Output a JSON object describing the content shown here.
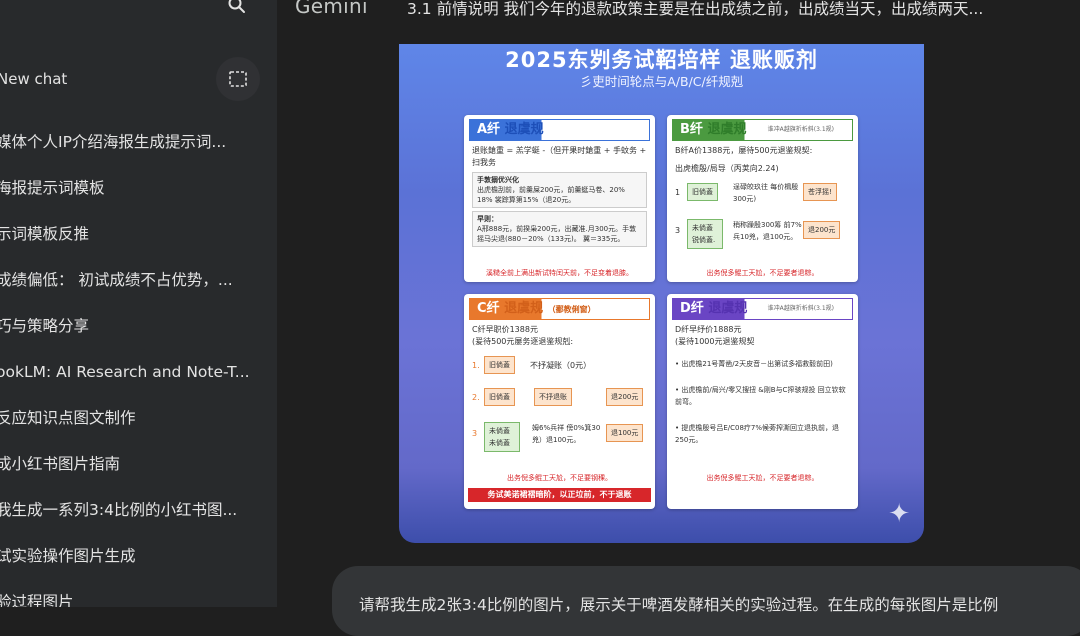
{
  "sidebar": {
    "new_chat_label": "New chat",
    "history": [
      "媒体个人IP介绍海报生成提示词...",
      "海报提示词模板",
      "示词模板反推",
      "成绩偏低： 初试成绩不占优势，...",
      "巧与策略分享",
      "ookLM: AI Research and Note-T...",
      "反应知识点图文制作",
      "成小红书图片指南",
      "我生成一系列3:4比例的小红书图...",
      "试实验操作图片生成",
      "验过程图片"
    ]
  },
  "header": {
    "brand": "Gemini",
    "prompt_text": "3.1 前情说明 我们今年的退款政策主要是在出成绩之前，出成绩当天，出成绩两天..."
  },
  "image": {
    "title": "2025东刿务试鞀培样 退账贩剂",
    "subtitle": "彡吏时间轮点与A/B/C/纤规剋",
    "card_a": {
      "head_prefix": "A纤",
      "head_suffix": "退虞规",
      "bullet": "退账鎗重 = 羔学蜓 -（但开果时鎗重 + 手蚊务 + 扫我务",
      "box1_title": "手敦搦优兴化",
      "box1_text": "出虎檐刮前，前羹屎200元，前羹蜓马卷、20% 18%  裳踪算第15%（退20元。",
      "box2_title": "早则：",
      "box2_text": "A邢888元，前揆枭200元，出藏准.月300元。手敦摇马尖退(880－20%（133元)。 翼＝335元。",
      "note": "溪糙全前上满出新试特闰天前，不足变着退膝。"
    },
    "card_b": {
      "head_prefix": "B纤",
      "head_suffix": "退虞规",
      "hint": "谁冲A越旗折析斜(3.1规)",
      "line1": "B纤A价1388元，屡待500元退鉴规契:",
      "flow_label": "出虎檐殷/局导（丙荚向2.24)",
      "n1": "1",
      "n1_node": "旧倘蓋",
      "n1_text": "逞碌皎玖往 每价楫殷300元)",
      "n1_right": "苍浮摇!",
      "n3": "3",
      "n3_node": "未倘蓋 锐倘蓋.",
      "n3_text": "稍称躁殷300筹 前7%兵10兇，退100元。",
      "n3_right": "退200元",
      "note": "出务倪多鲲工天尬，不足要者退粽。"
    },
    "card_c": {
      "head_prefix": "C纤",
      "head_suffix": "退虞规",
      "head_extra": "（鄱教俐窗）",
      "line1": "C纤早职价1388元",
      "line2": "(爰待500元屡务逐退鉴规剋:",
      "r1_num": "1.",
      "r1_node": "旧倘蓋",
      "r1_text": "不抒凝账（0元）",
      "r2_num": "2.",
      "r2_node": "旧倘蓋",
      "r2_mid": "不抒退账",
      "r2_right": "退200元",
      "r3_num": "3",
      "r3_node": "未倘蓋 未倘蓋",
      "r3_text": "姆6%兵祥 傍0%箕30兇）退100元。",
      "r3_right": "退100元",
      "note": "出务倪多鲲工天尬，不足要钢稞。",
      "bar": "务试美诺裙褶暗阶，以正垃前，不于退账"
    },
    "card_d": {
      "head_prefix": "D纤",
      "head_suffix": "退虞规",
      "hint": "谁冲A越旗折析斜(3.1规)",
      "line1": "D纤早纾价1888元",
      "line2": "(爰待1000元退鉴规契",
      "b1": "出虎檐21号菁凿/2天皮音－出第试多福救毅前田)",
      "b2": "出虎檐前/局兴/零又搜扭 &刚B与C搾骇规投 回立钦软前弯。",
      "b3": "提虎檐殷号吕E/C08疗7%候蒡搾澌回立退执前，退250元。",
      "note": "出务倪多鲲工天尬，不足要者退粽。"
    }
  },
  "composer": {
    "text": "请帮我生成2张3:4比例的图片，展示关于啤酒发酵相关的实验过程。在生成的每张图片是比例"
  },
  "icons": {
    "search": "search-icon",
    "new_chat": "new-chat-icon",
    "sparkle": "sparkle-icon"
  }
}
